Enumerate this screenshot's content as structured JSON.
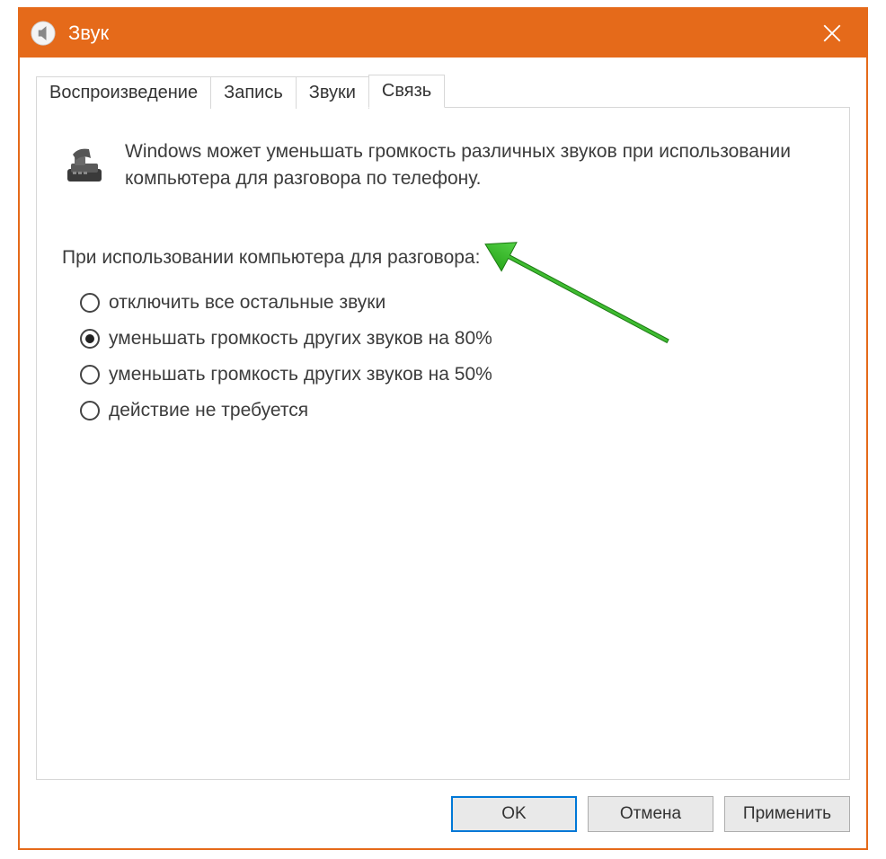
{
  "window": {
    "title": "Звук"
  },
  "tabs": [
    {
      "label": "Воспроизведение",
      "active": false
    },
    {
      "label": "Запись",
      "active": false
    },
    {
      "label": "Звуки",
      "active": false
    },
    {
      "label": "Связь",
      "active": true
    }
  ],
  "panel": {
    "info_text": "Windows может уменьшать громкость различных звуков при использовании компьютера для разговора по телефону.",
    "section_label": "При использовании компьютера для разговора:",
    "radio_options": [
      {
        "label": "отключить все остальные звуки",
        "selected": false
      },
      {
        "label": "уменьшать громкость других звуков на 80%",
        "selected": true
      },
      {
        "label": "уменьшать громкость других звуков на 50%",
        "selected": false
      },
      {
        "label": "действие не требуется",
        "selected": false
      }
    ]
  },
  "buttons": {
    "ok": "OK",
    "cancel": "Отмена",
    "apply": "Применить"
  }
}
